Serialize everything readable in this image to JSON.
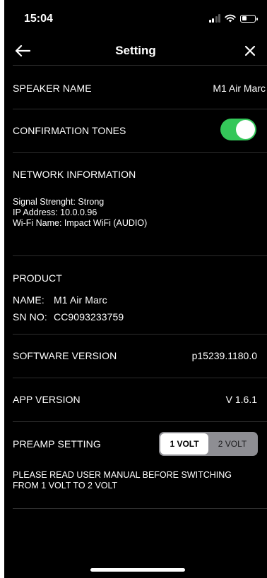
{
  "status": {
    "time": "15:04"
  },
  "nav": {
    "title": "Setting"
  },
  "speaker_name": {
    "label": "SPEAKER NAME",
    "value": "M1 Air Marc"
  },
  "confirmation_tones": {
    "label": "CONFIRMATION TONES",
    "enabled": true
  },
  "network": {
    "label": "NETWORK INFORMATION",
    "signal": "Signal Strenght: Strong",
    "ip": "IP Address: 10.0.0.96",
    "wifi": "Wi-Fi Name: Impact WiFi (AUDIO)"
  },
  "product": {
    "label": "PRODUCT",
    "name_key": "NAME:",
    "name_value": "M1 Air Marc",
    "sn_key": "SN NO:",
    "sn_value": "CC9093233759"
  },
  "software_version": {
    "label": "SOFTWARE VERSION",
    "value": "p15239.1180.0"
  },
  "app_version": {
    "label": "APP VERSION",
    "value": "V 1.6.1"
  },
  "preamp": {
    "label": "PREAMP SETTING",
    "options": [
      "1 VOLT",
      "2 VOLT"
    ],
    "selected": "1 VOLT",
    "warning_line1": "PLEASE READ USER MANUAL BEFORE SWITCHING",
    "warning_line2": "FROM 1 VOLT TO 2 VOLT"
  },
  "colors": {
    "background": "#000000",
    "toggle_on": "#34c759",
    "segment_bg": "#8e8e93"
  }
}
